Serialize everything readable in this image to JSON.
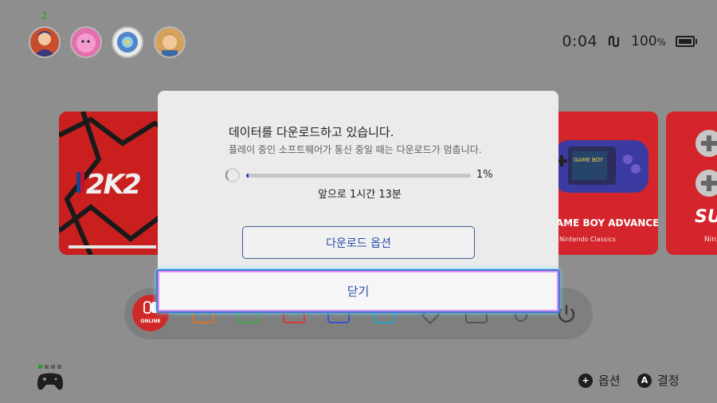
{
  "top_bar": {
    "user_count": "2",
    "users": [
      {
        "name": "user-1",
        "color": "#c84e2b"
      },
      {
        "name": "user-2",
        "color": "#e46fae"
      },
      {
        "name": "user-3",
        "color": "#4e86c8"
      },
      {
        "name": "user-4",
        "color": "#d5a25c"
      }
    ],
    "clock": "0:04",
    "battery": "100",
    "battery_unit": "%"
  },
  "games": {
    "tile_2k": {
      "logo": "2K2"
    },
    "tile_gba": {
      "logo": "GAME BOY ADVANCE",
      "sub": "Nintendo Classics",
      "device_label": "GAME BOY"
    },
    "tile_snes": {
      "logo": "SUP",
      "sub": "Nin"
    }
  },
  "dock": {
    "online_label": "ONLINE"
  },
  "dialog": {
    "title": "데이터를 다운로드하고 있습니다.",
    "subtitle": "플레이 중인 소프트웨어가 통신 중일 때는 다운로드가 멈춥니다.",
    "progress_percent": 1,
    "progress_label": "1%",
    "time_left": "앞으로 1시간 13분",
    "options_button": "다운로드 옵션",
    "close_button": "닫기"
  },
  "footer": {
    "options_glyph": "+",
    "options_label": "옵션",
    "confirm_glyph": "A",
    "confirm_label": "결정"
  }
}
